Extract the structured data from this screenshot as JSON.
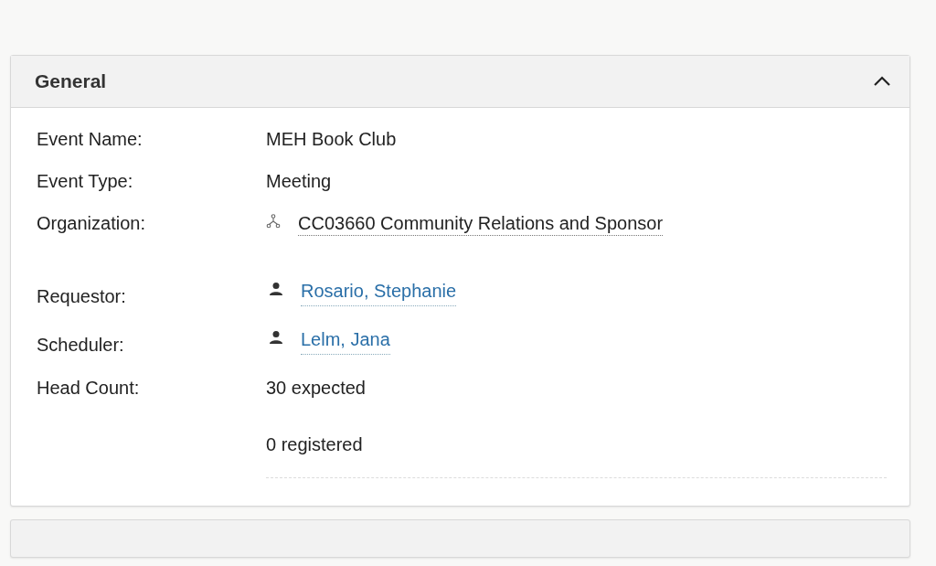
{
  "panel": {
    "title": "General",
    "expanded": true
  },
  "fields": [
    {
      "label": "Event Name:",
      "kind": "text",
      "values": [
        "MEH Book Club"
      ]
    },
    {
      "label": "Event Type:",
      "kind": "text",
      "values": [
        "Meeting"
      ]
    },
    {
      "label": "Organization:",
      "kind": "org",
      "values": [
        "CC03660 Community Relations and Sponsor"
      ]
    },
    {
      "label": "Requestor:",
      "kind": "person",
      "values": [
        "Rosario, Stephanie"
      ]
    },
    {
      "label": "Scheduler:",
      "kind": "person",
      "values": [
        "Lelm, Jana"
      ]
    },
    {
      "label": "Head Count:",
      "kind": "count",
      "values": [
        "30 expected",
        "0 registered"
      ]
    }
  ]
}
